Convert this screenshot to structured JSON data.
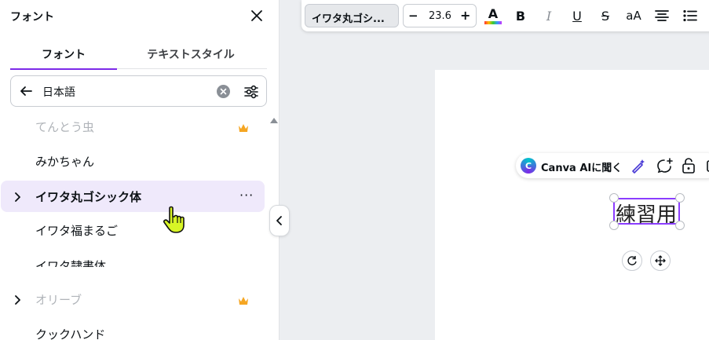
{
  "panel": {
    "title": "フォント",
    "tabs": [
      {
        "label": "フォント",
        "active": true
      },
      {
        "label": "テキストスタイル",
        "active": false
      }
    ],
    "search": {
      "value": "日本語"
    },
    "fonts": [
      {
        "name": "てんとう虫",
        "premium": true,
        "expandable": false,
        "dim": true
      },
      {
        "name": "みかちゃん",
        "premium": false,
        "expandable": false,
        "dim": false
      },
      {
        "name": "イワタ丸ゴシック体",
        "premium": false,
        "expandable": true,
        "selected": true,
        "dim": false
      },
      {
        "name": "イワタ福まるご",
        "premium": false,
        "expandable": false,
        "dim": false
      },
      {
        "name": "イワタ隷書体",
        "premium": false,
        "expandable": false,
        "dim": false
      },
      {
        "name": "オリーブ",
        "premium": true,
        "expandable": true,
        "dim": true
      },
      {
        "name": "クックハンド",
        "premium": false,
        "expandable": false,
        "dim": false
      }
    ],
    "more_label": "···"
  },
  "toolbar": {
    "font_name": "イワタ丸ゴシ...",
    "font_size": "23.6",
    "minus": "−",
    "plus": "+",
    "case_label": "aA"
  },
  "canvas": {
    "ai_label": "Canva AIに聞く",
    "text": "練習用"
  },
  "colors": {
    "accent": "#7d2ae8",
    "selected_row": "#efe9fb",
    "crown": "#f5a623"
  }
}
